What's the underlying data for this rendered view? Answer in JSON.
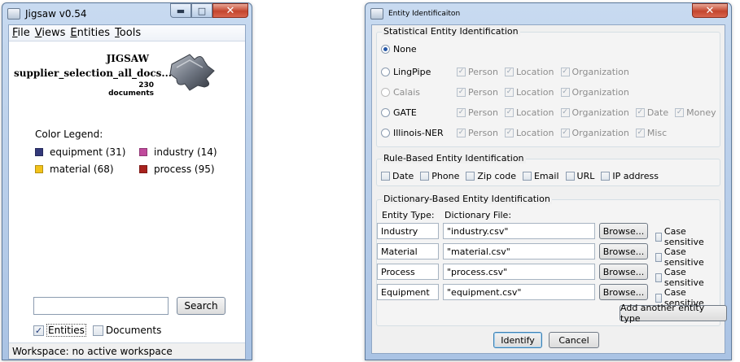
{
  "jigsaw": {
    "title": "Jigsaw v0.54",
    "menu": [
      {
        "label": "File",
        "mnemonic": "F",
        "rest": "ile"
      },
      {
        "label": "Views",
        "mnemonic": "V",
        "rest": "iews"
      },
      {
        "label": "Entities",
        "mnemonic": "E",
        "rest": "ntities"
      },
      {
        "label": "Tools",
        "mnemonic": "T",
        "rest": "ools"
      }
    ],
    "app_name": "JIGSAW",
    "workspace_name": "supplier_selection_all_docs...",
    "document_count": "230 documents",
    "legend_title": "Color Legend:",
    "legend": [
      {
        "label": "equipment (31)",
        "color": "#33397a"
      },
      {
        "label": "industry (14)",
        "color": "#c04a9c"
      },
      {
        "label": "material (68)",
        "color": "#f2c21a"
      },
      {
        "label": "process (95)",
        "color": "#a8221e"
      }
    ],
    "search_value": "",
    "search_button": "Search",
    "entities_checkbox": {
      "label": "Entities",
      "checked": true
    },
    "documents_checkbox": {
      "label": "Documents",
      "checked": false
    },
    "status": "Workspace: no active workspace"
  },
  "dialog": {
    "title": "Entity Identificaiton",
    "statistical": {
      "group_label": "Statistical Entity Identification",
      "none_label": "None",
      "methods": [
        {
          "label": "LingPipe",
          "options": [
            "Person",
            "Location",
            "Organization"
          ]
        },
        {
          "label": "Calais",
          "options": [
            "Person",
            "Location",
            "Organization"
          ]
        },
        {
          "label": "GATE",
          "options": [
            "Person",
            "Location",
            "Organization",
            "Date",
            "Money"
          ]
        },
        {
          "label": "Illinois-NER",
          "options": [
            "Person",
            "Location",
            "Organization",
            "Misc"
          ]
        }
      ]
    },
    "rule_based": {
      "group_label": "Rule-Based Entity Identification",
      "options": [
        "Date",
        "Phone",
        "Zip code",
        "Email",
        "URL",
        "IP address"
      ]
    },
    "dictionary": {
      "group_label": "Dictionary-Based Entity Identification",
      "col_entity_type": "Entity Type:",
      "col_dictionary_file": "Dictionary File:",
      "rows": [
        {
          "type": "Industry",
          "file": "\"industry.csv\""
        },
        {
          "type": "Material",
          "file": "\"material.csv\""
        },
        {
          "type": "Process",
          "file": "\"process.csv\""
        },
        {
          "type": "Equipment",
          "file": "\"equipment.csv\""
        }
      ],
      "browse_label": "Browse...",
      "case_label": "Case sensitive",
      "add_button": "Add another entity type"
    },
    "identify_button": "Identify",
    "cancel_button": "Cancel"
  }
}
